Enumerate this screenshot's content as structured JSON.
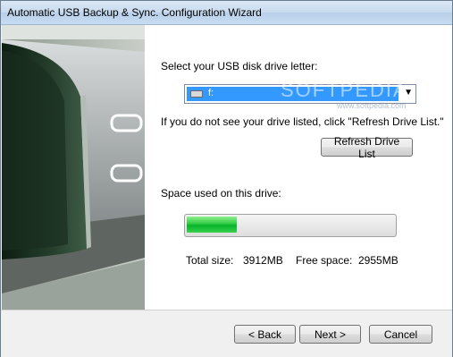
{
  "window": {
    "title": "Automatic USB Backup & Sync. Configuration Wizard"
  },
  "drive_select": {
    "label": "Select your USB disk drive letter:",
    "selected": "f:",
    "hint": "If you do not see your drive listed, click \"Refresh Drive List.\"",
    "refresh_label": "Refresh Drive List"
  },
  "space": {
    "label": "Space used on this drive:",
    "used_fraction": 0.24,
    "total_label": "Total size:",
    "total_value": "3912MB",
    "free_label": "Free space:",
    "free_value": "2955MB"
  },
  "watermark": {
    "brand": "SOFTPEDIA",
    "site": "www.softpedia.com"
  },
  "footer": {
    "back_label": "< Back",
    "next_label": "Next >",
    "cancel_label": "Cancel"
  },
  "colors": {
    "progress_fill": "#07b42a",
    "selection": "#3399ff"
  }
}
